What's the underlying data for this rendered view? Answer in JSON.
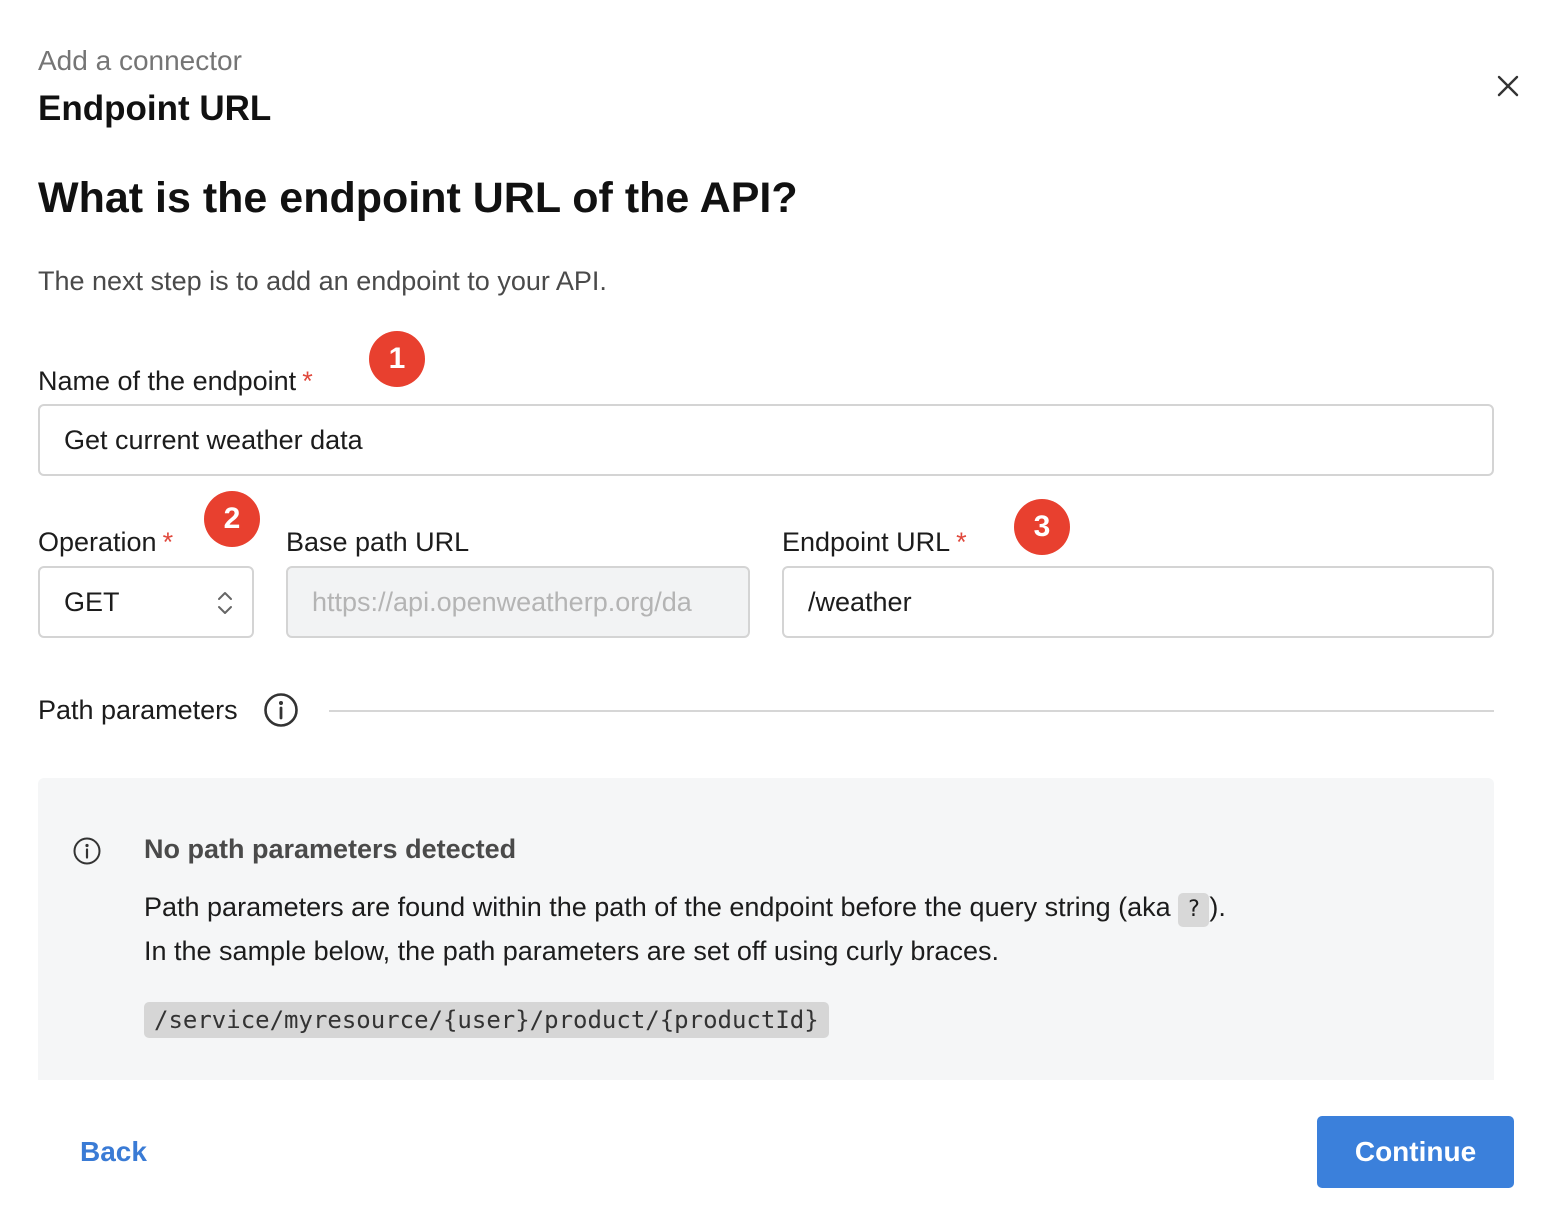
{
  "header": {
    "eyebrow": "Add a connector",
    "step_title": "Endpoint URL"
  },
  "main": {
    "heading": "What is the endpoint URL of the API?",
    "description": "The next step is to add an endpoint to your API."
  },
  "form": {
    "required_marker": "*",
    "name_field": {
      "label": "Name of the endpoint",
      "value": "Get current weather data",
      "badge": "1"
    },
    "operation_field": {
      "label": "Operation",
      "value": "GET",
      "badge": "2"
    },
    "base_path_field": {
      "label": "Base path URL",
      "value": "https://api.openweatherp.org/da"
    },
    "endpoint_url_field": {
      "label": "Endpoint URL",
      "value": "/weather",
      "badge": "3"
    }
  },
  "path_parameters": {
    "section_label": "Path parameters",
    "panel": {
      "title": "No path parameters detected",
      "line1_before": "Path parameters are found within the path of the endpoint before the query string (aka",
      "line1_code": "?",
      "line1_after": ").",
      "line2": "In the sample below, the path parameters are set off using curly braces.",
      "code_sample": "/service/myresource/{user}/product/{productId}"
    }
  },
  "footer": {
    "back_label": "Back",
    "continue_label": "Continue"
  },
  "colors": {
    "accent": "#3b80db",
    "badge": "#e8402f",
    "required": "#e0483c",
    "panel_bg": "#f5f6f7"
  },
  "icons": {
    "close": "close-icon",
    "select": "select-arrows-icon",
    "section_info": "info-icon",
    "panel_info": "info-icon"
  }
}
